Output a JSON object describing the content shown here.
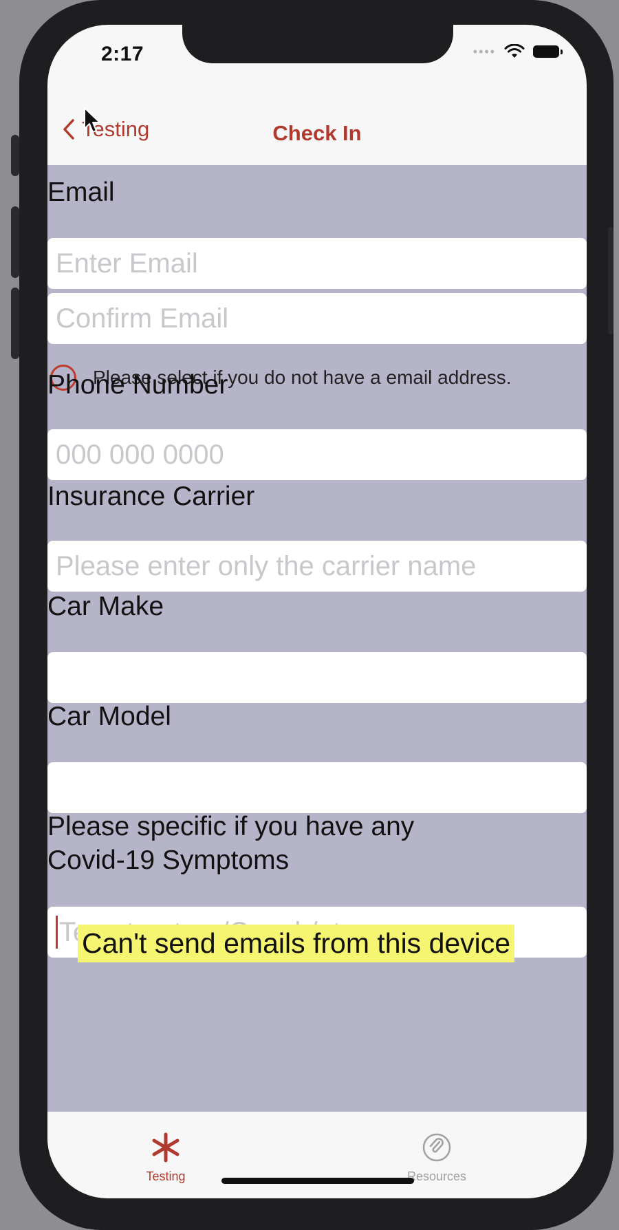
{
  "status_bar": {
    "time": "2:17"
  },
  "nav": {
    "back_label": "Testing",
    "title": "Check In"
  },
  "form": {
    "email_label": "Email",
    "email_placeholder": "Enter Email",
    "confirm_email_placeholder": "Confirm Email",
    "no_email_option": "Please select if you do not have a email address.",
    "phone_label": "Phone Number",
    "phone_placeholder": "000 000 0000",
    "insurance_label": "Insurance Carrier",
    "insurance_placeholder": "Please enter only the carrier name",
    "car_make_label": "Car Make",
    "car_make_value": "",
    "car_model_label": "Car Model",
    "car_model_value": "",
    "symptoms_label_line1": "Please specific if you have any",
    "symptoms_label_line2": "Covid-19 Symptoms",
    "symptoms_placeholder": "Tempterature/Cough/etc.",
    "warning": "Can't send emails from this device"
  },
  "tabbar": {
    "tabs": [
      {
        "label": "Testing",
        "icon": "asterisk-icon",
        "active": true
      },
      {
        "label": "Resources",
        "icon": "paperclip-icon",
        "active": false
      }
    ]
  },
  "colors": {
    "accent": "#b03a2e",
    "form_background": "#b5b4c9",
    "warning_highlight": "#f5f571"
  }
}
